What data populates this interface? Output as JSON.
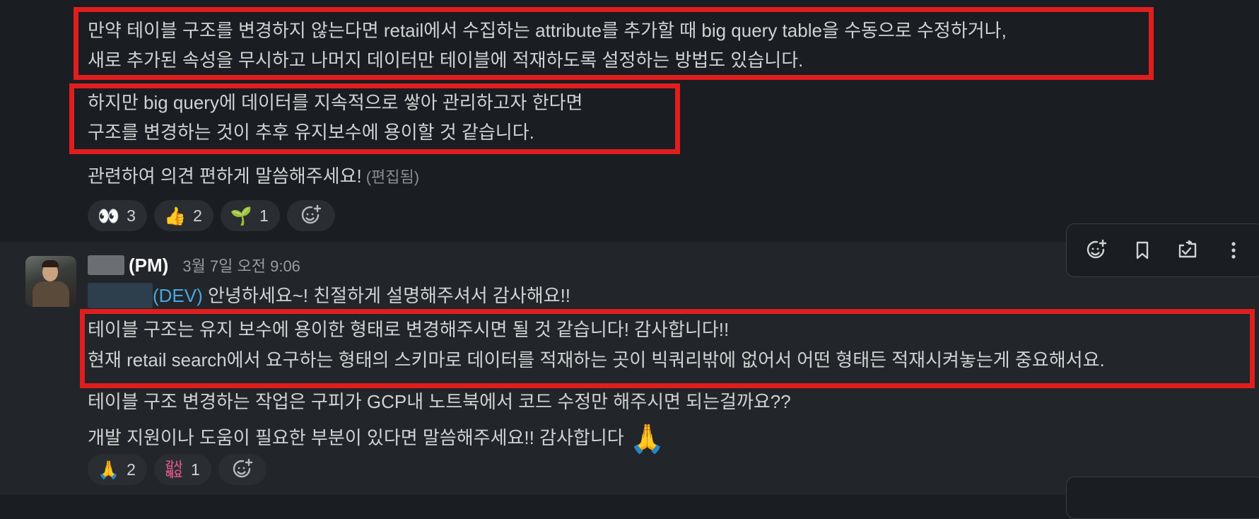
{
  "message1": {
    "para1": [
      "만약 테이블 구조를 변경하지 않는다면 retail에서 수집하는 attribute를 추가할 때 big query table을 수동으로 수정하거나,",
      "새로 추가된 속성을 무시하고 나머지 데이터만 테이블에 적재하도록 설정하는 방법도 있습니다."
    ],
    "para2": [
      "하지만 big query에 데이터를 지속적으로 쌓아 관리하고자 한다면",
      "구조를 변경하는 것이 추후 유지보수에 용이할 것 같습니다."
    ],
    "para3": "관련하여 의견 편하게 말씀해주세요!",
    "edited_label": "(편집됨)",
    "reactions": [
      {
        "emoji": "👀",
        "count": "3"
      },
      {
        "emoji": "👍",
        "count": "2"
      },
      {
        "emoji": "🌱",
        "count": "1"
      }
    ]
  },
  "message2": {
    "username": "(PM)",
    "timestamp": "3월 7일 오전 9:06",
    "mention": "(DEV)",
    "greeting": "안녕하세요~! 친절하게 설명해주셔서 감사해요!!",
    "para1": [
      "테이블 구조는 유지 보수에 용이한 형태로 변경해주시면 될 것 같습니다! 감사합니다!!",
      "현재 retail search에서 요구하는 형태의 스키마로 데이터를 적재하는 곳이 빅쿼리밖에 없어서 어떤 형태든 적재시켜놓는게 중요해서요."
    ],
    "para2": [
      "테이블 구조 변경하는 작업은 구피가 GCP내 노트북에서 코드 수정만 해주시면 되는걸까요??",
      "개발 지원이나 도움이 필요한 부분이 있다면 말씀해주세요!! 감사합니다"
    ],
    "inline_emoji": "🙏",
    "reactions": [
      {
        "emoji": "🙏",
        "count": "2"
      },
      {
        "emoji_text": [
          "감사",
          "해요"
        ],
        "count": "1"
      }
    ]
  },
  "toolbar": {
    "icons": [
      "add-reaction-icon",
      "bookmark-icon",
      "forward-icon",
      "more-options-icon"
    ]
  },
  "colors": {
    "background": "#1a1d21",
    "hover_background": "#222529",
    "highlight_box": "#e01e1e",
    "mention": "#4aa8e0"
  }
}
